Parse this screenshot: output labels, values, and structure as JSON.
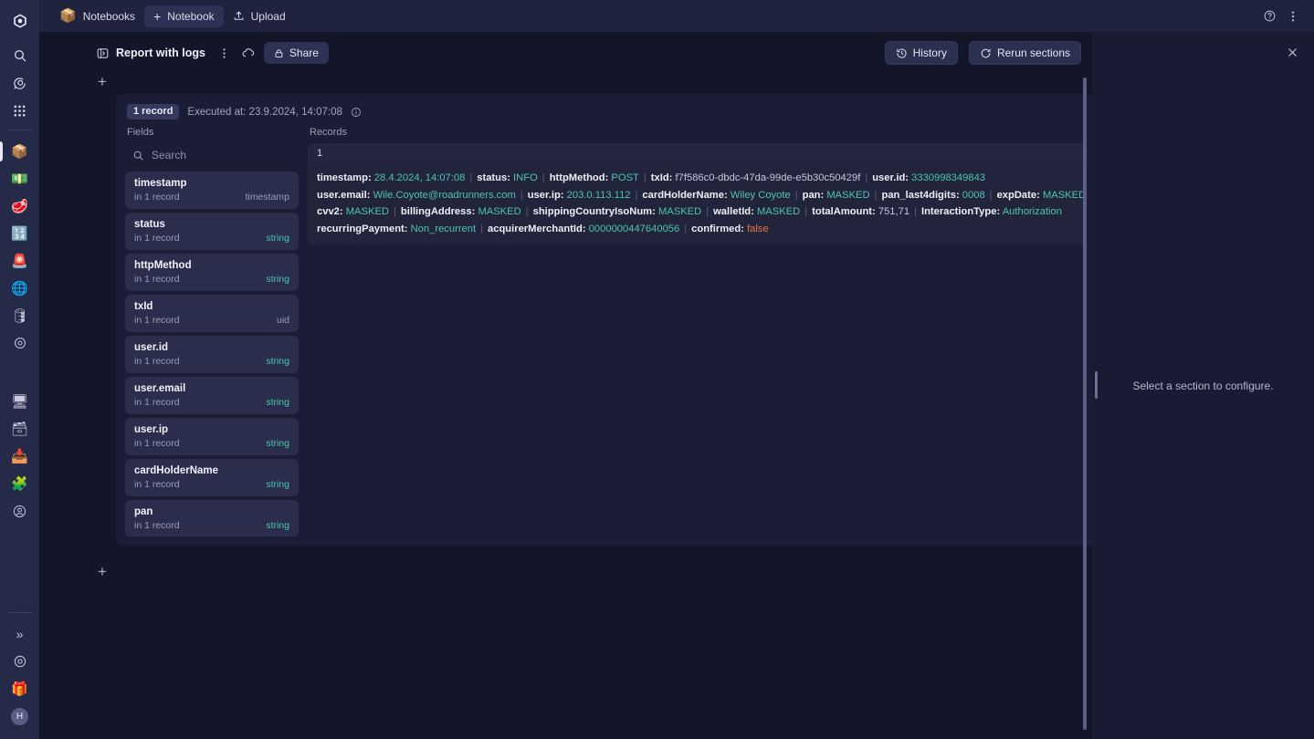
{
  "app": {
    "accent": "#4dc5ae",
    "bg": "#15152a",
    "panel_bg": "#1b1d36"
  },
  "rail": {
    "items": [
      {
        "name": "logo",
        "glyph": "⬟",
        "kind": "logo"
      },
      {
        "name": "search",
        "glyph": "🔍",
        "kind": "line"
      },
      {
        "name": "assistant",
        "glyph": "💬",
        "kind": "line"
      },
      {
        "name": "apps-grid",
        "glyph": "∷",
        "kind": "grid"
      },
      {
        "name": "notebooks",
        "glyph": "📦",
        "kind": "emoji",
        "active": true
      },
      {
        "name": "dashboards",
        "glyph": "💵",
        "kind": "emoji"
      },
      {
        "name": "logs",
        "glyph": "🥩",
        "kind": "emoji"
      },
      {
        "name": "metrics",
        "glyph": "🔢",
        "kind": "emoji"
      },
      {
        "name": "alerts",
        "glyph": "🚨",
        "kind": "emoji"
      },
      {
        "name": "traces",
        "glyph": "🌐",
        "kind": "emoji"
      },
      {
        "name": "databases",
        "glyph": "🛢",
        "kind": "emoji"
      },
      {
        "name": "settings-gear",
        "glyph": "⚙",
        "kind": "line"
      },
      {
        "name": "monitoring",
        "glyph": "🖥",
        "kind": "emoji"
      },
      {
        "name": "storage",
        "glyph": "🗃",
        "kind": "emoji"
      },
      {
        "name": "pipelines",
        "glyph": "📥",
        "kind": "emoji"
      },
      {
        "name": "kubernetes",
        "glyph": "🧩",
        "kind": "emoji"
      },
      {
        "name": "profile-circle",
        "glyph": "ⓘ",
        "kind": "line"
      }
    ],
    "bottom": [
      {
        "name": "expand-sidebar",
        "glyph": "»"
      },
      {
        "name": "help-circle",
        "glyph": "?"
      },
      {
        "name": "whats-new",
        "glyph": "🎁"
      },
      {
        "name": "user-avatar",
        "glyph": "H"
      }
    ]
  },
  "topbar": {
    "notebooks_label": "Notebooks",
    "new_notebook_label": "Notebook",
    "upload_label": "Upload",
    "help_title": "Help",
    "more_title": "More options"
  },
  "doc": {
    "title": "Report with logs",
    "more_title": "More",
    "cloud_title": "Sync",
    "share_label": "Share",
    "history_label": "History",
    "rerun_label": "Rerun sections",
    "add_section_top_title": "Add section",
    "add_section_bottom_title": "Add section"
  },
  "section": {
    "record_badge": "1 record",
    "executed_at": "Executed at: 23.9.2024, 14:07:08",
    "info_title": "Info",
    "fields_label": "Fields",
    "records_label": "Records",
    "search_placeholder": "Search",
    "search_value": "",
    "fields": [
      {
        "name": "timestamp",
        "count": "in 1 record",
        "type": "timestamp",
        "type_kind": "other"
      },
      {
        "name": "status",
        "count": "in 1 record",
        "type": "string",
        "type_kind": "string"
      },
      {
        "name": "httpMethod",
        "count": "in 1 record",
        "type": "string",
        "type_kind": "string"
      },
      {
        "name": "txId",
        "count": "in 1 record",
        "type": "uid",
        "type_kind": "other"
      },
      {
        "name": "user.id",
        "count": "in 1 record",
        "type": "string",
        "type_kind": "string"
      },
      {
        "name": "user.email",
        "count": "in 1 record",
        "type": "string",
        "type_kind": "string"
      },
      {
        "name": "user.ip",
        "count": "in 1 record",
        "type": "string",
        "type_kind": "string"
      },
      {
        "name": "cardHolderName",
        "count": "in 1 record",
        "type": "string",
        "type_kind": "string"
      },
      {
        "name": "pan",
        "count": "in 1 record",
        "type": "string",
        "type_kind": "string"
      }
    ],
    "records_row_number": "1",
    "record_lines": [
      [
        {
          "key": "timestamp",
          "value": "28.4.2024, 14:07:08",
          "style": "accent"
        },
        {
          "key": "status",
          "value": "INFO",
          "style": "accent"
        },
        {
          "key": "httpMethod",
          "value": "POST",
          "style": "accent"
        },
        {
          "key": "txId",
          "value": "f7f586c0-dbdc-47da-99de-e5b30c50429f",
          "style": "plain"
        },
        {
          "key": "user.id",
          "value": "3330998349843",
          "style": "accent"
        }
      ],
      [
        {
          "key": "user.email",
          "value": "Wile.Coyote@roadrunners.com",
          "style": "accent"
        },
        {
          "key": "user.ip",
          "value": "203.0.113.112",
          "style": "accent"
        },
        {
          "key": "cardHolderName",
          "value": "Wiley Coyote",
          "style": "accent"
        },
        {
          "key": "pan",
          "value": "MASKED",
          "style": "accent"
        },
        {
          "key": "pan_last4digits",
          "value": "0008",
          "style": "accent"
        },
        {
          "key": "expDate",
          "value": "MASKED",
          "style": "accent"
        }
      ],
      [
        {
          "key": "cvv2",
          "value": "MASKED",
          "style": "accent"
        },
        {
          "key": "billingAddress",
          "value": "MASKED",
          "style": "accent"
        },
        {
          "key": "shippingCountryIsoNum",
          "value": "MASKED",
          "style": "accent"
        },
        {
          "key": "walletId",
          "value": "MASKED",
          "style": "accent"
        },
        {
          "key": "totalAmount",
          "value": "751,71",
          "style": "plain"
        },
        {
          "key": "InteractionType",
          "value": "Authorization",
          "style": "accent"
        }
      ],
      [
        {
          "key": "recurringPayment",
          "value": "Non_recurrent",
          "style": "accent"
        },
        {
          "key": "acquirerMerchantId",
          "value": "0000000447640056",
          "style": "accent"
        },
        {
          "key": "confirmed",
          "value": "false",
          "style": "bool-false"
        }
      ]
    ]
  },
  "right_panel": {
    "empty_text": "Select a section to configure.",
    "close_title": "Close panel",
    "resize_title": "Resize panel"
  }
}
